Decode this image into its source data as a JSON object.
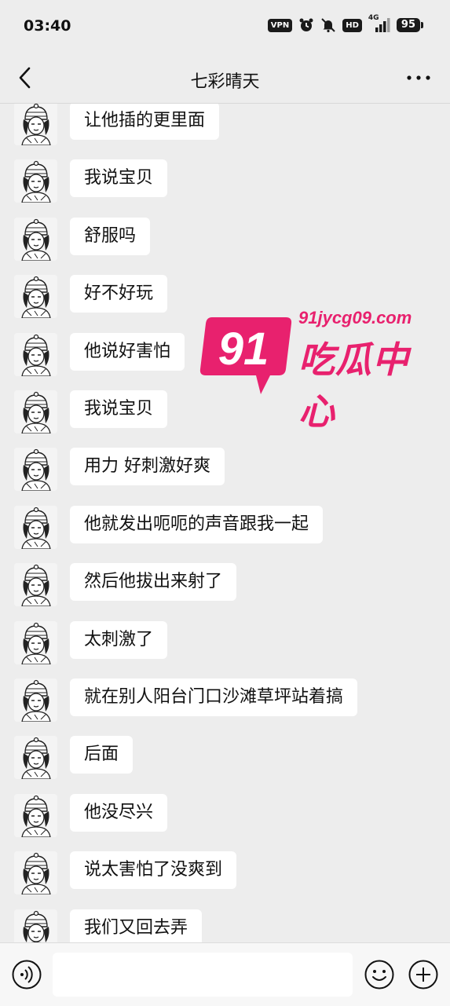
{
  "status_bar": {
    "time": "03:40",
    "vpn_label": "VPN",
    "hd_label": "HD",
    "network_label": "4G",
    "battery_level": "95",
    "icons": [
      "alarm-icon",
      "mute-bell-icon",
      "signal-icon"
    ]
  },
  "nav": {
    "title": "七彩晴天",
    "back_icon": "chevron-left-icon",
    "more_icon": "more-dots-icon"
  },
  "messages": [
    {
      "text": "让他插的更里面",
      "sender": "contact"
    },
    {
      "text": "我说宝贝",
      "sender": "contact"
    },
    {
      "text": "舒服吗",
      "sender": "contact"
    },
    {
      "text": "好不好玩",
      "sender": "contact"
    },
    {
      "text": "他说好害怕",
      "sender": "contact"
    },
    {
      "text": "我说宝贝",
      "sender": "contact"
    },
    {
      "text": "用力 好刺激好爽",
      "sender": "contact"
    },
    {
      "text": "他就发出呃呃的声音跟我一起",
      "sender": "contact"
    },
    {
      "text": "然后他拔出来射了",
      "sender": "contact"
    },
    {
      "text": "太刺激了",
      "sender": "contact"
    },
    {
      "text": "就在别人阳台门口沙滩草坪站着搞",
      "sender": "contact"
    },
    {
      "text": "后面",
      "sender": "contact"
    },
    {
      "text": "他没尽兴",
      "sender": "contact"
    },
    {
      "text": "说太害怕了没爽到",
      "sender": "contact"
    },
    {
      "text": "我们又回去弄",
      "sender": "contact"
    }
  ],
  "watermark": {
    "badge_number": "91",
    "url": "91jycg09.com",
    "brand_text": "吃瓜中心",
    "color": "#e8216e"
  },
  "input_bar": {
    "value": "",
    "voice_icon": "voice-icon",
    "emoji_icon": "emoji-icon",
    "plus_icon": "plus-icon"
  }
}
